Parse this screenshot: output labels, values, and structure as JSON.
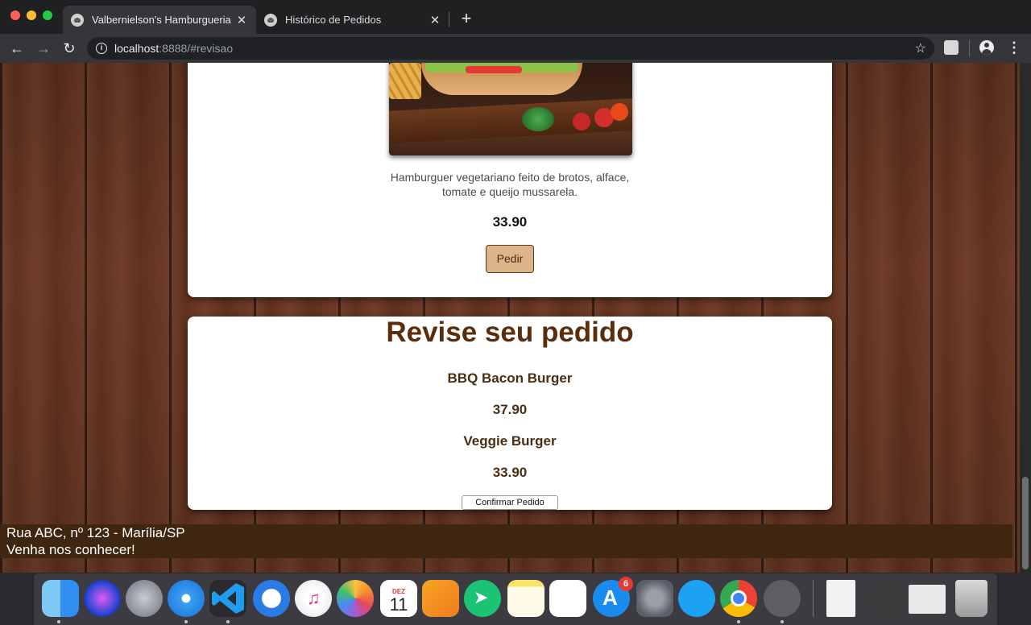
{
  "browser": {
    "tabs": [
      {
        "title": "Valbernielson's Hamburgueria",
        "close": "✕"
      },
      {
        "title": "Histórico de Pedidos",
        "close": "✕"
      }
    ],
    "new_tab": "+",
    "url_host": "localhost",
    "url_path": ":8888/#revisao",
    "back": "←",
    "forward": "→",
    "reload": "↻",
    "info": "i",
    "star": "☆",
    "menu": "⋮"
  },
  "product": {
    "description": "Hamburguer vegetariano feito de brotos, alface, tomate e queijo mussarela.",
    "price": "33.90",
    "order_button": "Pedir"
  },
  "review": {
    "title": "Revise seu pedido",
    "items": [
      {
        "name": "BBQ Bacon Burger",
        "price": "37.90"
      },
      {
        "name": "Veggie Burger",
        "price": "33.90"
      }
    ],
    "confirm_button": "Confirmar Pedido"
  },
  "footer": {
    "address": "Rua ABC, nº 123 - Marília/SP",
    "tagline": "Venha nos conhecer!"
  },
  "dock": {
    "calendar_month": "DEZ",
    "calendar_day": "11",
    "appstore_badge": "6",
    "apps": [
      "finder-icon",
      "siri-icon",
      "launchpad-icon",
      "safari-icon",
      "vscode-icon",
      "spark-icon",
      "music-icon",
      "photos-icon",
      "calendar-icon",
      "pages-icon",
      "direct-mail-icon",
      "notes-icon",
      "reminders-icon",
      "app-store-icon",
      "system-preferences-icon",
      "twitter-icon",
      "chrome-icon",
      "tableplus-icon",
      "document-icon",
      "screenshot-icon",
      "screenshot-2-icon",
      "trash-icon"
    ]
  }
}
